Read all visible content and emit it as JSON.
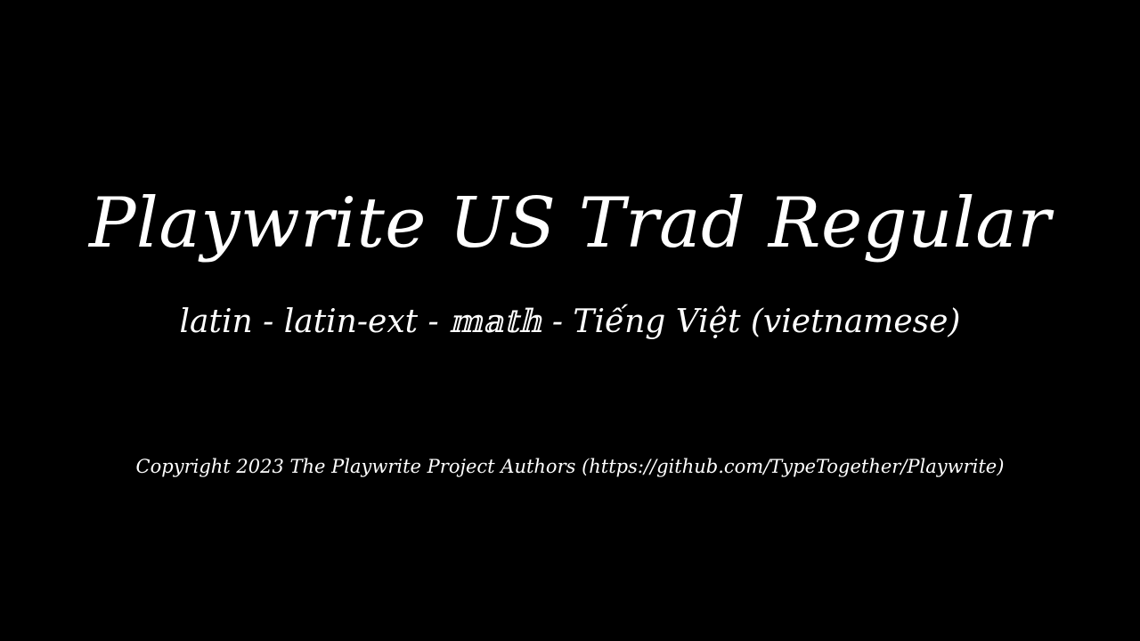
{
  "page": {
    "title": "Playwrite US Trad Regular",
    "subtitle": "latin - latin-ext - 𝕞𝕒𝕥𝕙 - Tiếng Việt (vietnamese)",
    "copyright": "Copyright 2023 The Playwrite Project Authors (https://github.com/TypeTogether/Playwrite)"
  },
  "colors": {
    "background": "#000000",
    "text": "#ffffff"
  }
}
